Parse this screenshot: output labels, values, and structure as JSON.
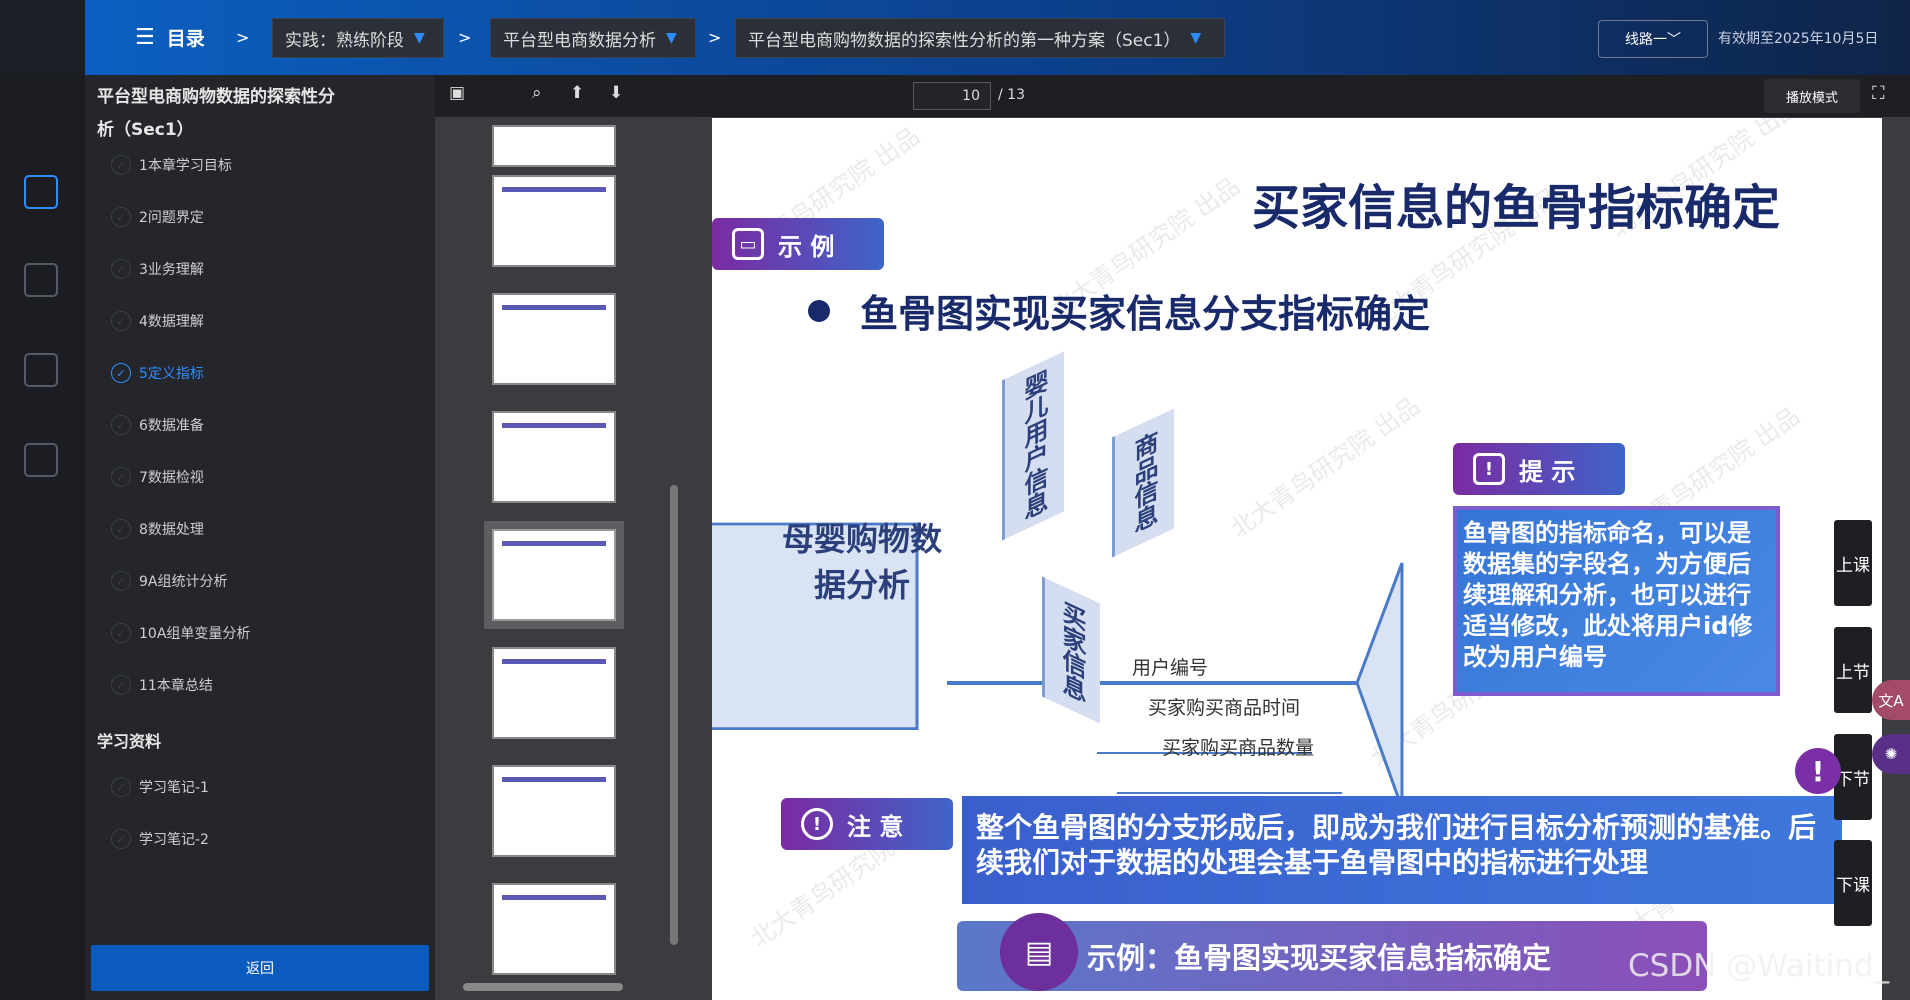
{
  "topbar": {
    "menu_label": "目录",
    "crumbs": [
      "实践：熟练阶段",
      "平台型电商数据分析",
      "平台型电商购物数据的探索性分析的第一种方案（Sec1）"
    ],
    "route_label": "线路一",
    "validity": "有效期至2025年10月5日"
  },
  "toc": {
    "title": "平台型电商购物数据的探索性分析（Sec1）",
    "items": [
      "1本章学习目标",
      "2问题界定",
      "3业务理解",
      "4数据理解",
      "5定义指标",
      "6数据准备",
      "7数据检视",
      "8数据处理",
      "9A组统计分析",
      "10A组单变量分析",
      "11本章总结"
    ],
    "active_index": 4,
    "section2": "学习资料",
    "notes": [
      "学习笔记-1",
      "学习笔记-2"
    ],
    "back_label": "返回"
  },
  "viewer": {
    "page_current": "10",
    "page_total": "/ 13",
    "play_label": "播放模式"
  },
  "slide": {
    "title": "买家信息的鱼骨指标确定",
    "example_tag": "示  例",
    "bullet": "鱼骨图实现买家信息分支指标确定",
    "fish_head": "母婴购物数据分析",
    "bones": [
      "婴儿用户信息",
      "商品信息",
      "买家信息"
    ],
    "sub_items": [
      "用户编号",
      "买家购买商品时间",
      "买家购买商品数量"
    ],
    "hint_tag": "提  示",
    "hint_text": "鱼骨图的指标命名，可以是数据集的字段名，为方便后续理解和分析，也可以进行适当修改，此处将用户id修改为用户编号",
    "note_tag": "注  意",
    "note_text": "整个鱼骨图的分支形成后，即成为我们进行目标分析预测的基准。后续我们对于数据的处理会基于鱼骨图中的指标进行处理",
    "bottom_text": "示例：鱼骨图实现买家信息指标确定",
    "watermark": "北大青鸟研究院 出品"
  },
  "side_buttons": [
    "上课",
    "上节",
    "下节",
    "下课"
  ],
  "csdn": "CSDN @Waitind_"
}
